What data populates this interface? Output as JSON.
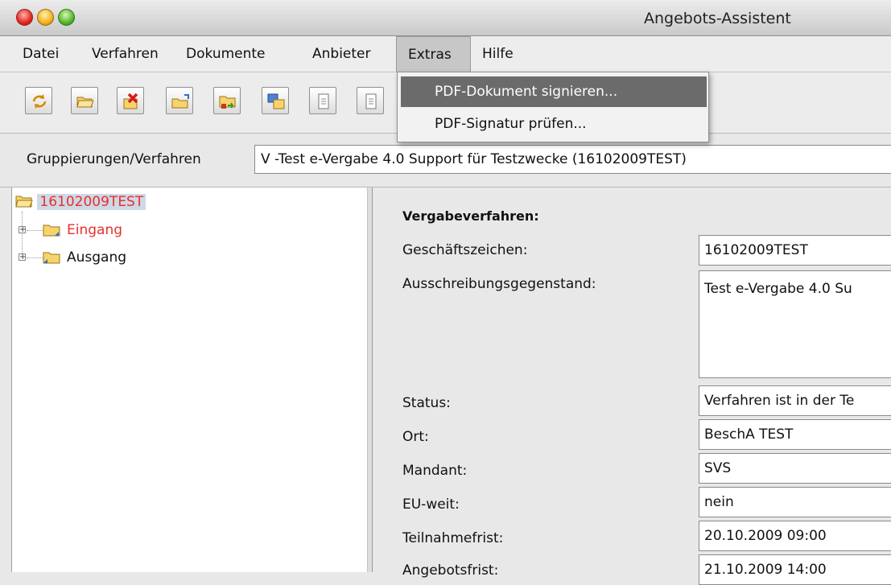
{
  "window": {
    "title": "Angebots-Assistent"
  },
  "menubar": {
    "items": [
      {
        "label": "Datei"
      },
      {
        "label": "Verfahren"
      },
      {
        "label": "Dokumente"
      },
      {
        "label": "Anbieter"
      },
      {
        "label": "Extras"
      },
      {
        "label": "Hilfe"
      }
    ]
  },
  "extras_menu": {
    "items": [
      {
        "label": "PDF-Dokument signieren..."
      },
      {
        "label": "PDF-Signatur prüfen..."
      }
    ]
  },
  "toolbar": {
    "buttons": [
      "refresh-icon",
      "open-folder-icon",
      "delete-icon",
      "new-folder-icon",
      "import-icon",
      "move-icon",
      "document-icon",
      "document-icon"
    ]
  },
  "groups": {
    "label": "Gruppierungen/Verfahren",
    "selected": "V -Test e-Vergabe 4.0 Support für Testzwecke (16102009TEST)"
  },
  "tree": {
    "root": "16102009TEST",
    "children": [
      {
        "label": "Eingang"
      },
      {
        "label": "Ausgang"
      }
    ]
  },
  "details": {
    "section_title": "Vergabeverfahren:",
    "fields": [
      {
        "label": "Geschäftszeichen:",
        "value": "16102009TEST"
      },
      {
        "label": "Ausschreibungsgegenstand:",
        "value": "Test e-Vergabe 4.0 Su"
      },
      {
        "label": "Status:",
        "value": "Verfahren ist in der Te"
      },
      {
        "label": "Ort:",
        "value": "BeschA TEST"
      },
      {
        "label": "Mandant:",
        "value": "SVS"
      },
      {
        "label": "EU-weit:",
        "value": "nein"
      },
      {
        "label": "Teilnahmefrist:",
        "value": "20.10.2009 09:00"
      },
      {
        "label": "Angebotsfrist:",
        "value": "21.10.2009 14:00"
      }
    ]
  }
}
